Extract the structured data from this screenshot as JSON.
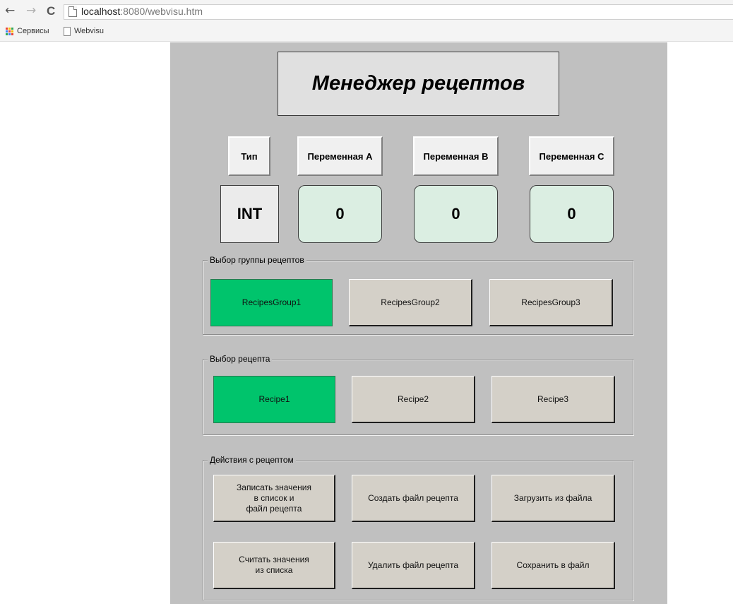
{
  "browser": {
    "back_icon": "←",
    "forward_icon": "→",
    "reload_icon": "C",
    "url_host": "localhost",
    "url_rest": ":8080/webvisu.htm",
    "bookmarks": [
      {
        "label": "Сервисы",
        "icon": "apps-grid-icon"
      },
      {
        "label": "Webvisu",
        "icon": "page-icon"
      }
    ]
  },
  "colors": {
    "canvas": "#c0c0c0",
    "active_button": "#00c46c",
    "button": "#d4d0c8",
    "value_field": "#dbeee2"
  },
  "title": "Менеджер рецептов",
  "headers": {
    "type": "Тип",
    "var_a": "Переменная A",
    "var_b": "Переменная B",
    "var_c": "Переменная C"
  },
  "values": {
    "type": "INT",
    "var_a": "0",
    "var_b": "0",
    "var_c": "0"
  },
  "recipe_groups": {
    "legend": "Выбор группы рецептов",
    "items": [
      "RecipesGroup1",
      "RecipesGroup2",
      "RecipesGroup3"
    ],
    "selected": "RecipesGroup1"
  },
  "recipes": {
    "legend": "Выбор рецепта",
    "items": [
      "Recipe1",
      "Recipe2",
      "Recipe3"
    ],
    "selected": "Recipe1"
  },
  "actions": {
    "legend": "Действия с рецептом",
    "write_values": "Записать значения\nв список и\nфайл рецепта",
    "create_file": "Создать файл рецепта",
    "load_from_file": "Загрузить из файла",
    "read_values": "Считать значения\nиз списка",
    "delete_file": "Удалить файл рецепта",
    "save_to_file": "Сохранить в файл"
  }
}
